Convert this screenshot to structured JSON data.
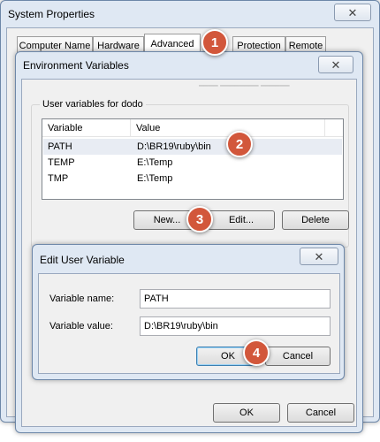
{
  "system_properties": {
    "title": "System Properties",
    "close_glyph": "✕",
    "tabs": [
      {
        "label": "Computer Name"
      },
      {
        "label": "Hardware"
      },
      {
        "label": "Advanced",
        "active": true
      },
      {
        "label": "Protection"
      },
      {
        "label": "Remote"
      }
    ]
  },
  "env_vars": {
    "title": "Environment Variables",
    "close_glyph": "✕",
    "user_group_label": "User variables for dodo",
    "columns": [
      "Variable",
      "Value"
    ],
    "rows": [
      {
        "variable": "PATH",
        "value": "D:\\BR19\\ruby\\bin",
        "selected": true
      },
      {
        "variable": "TEMP",
        "value": "E:\\Temp"
      },
      {
        "variable": "TMP",
        "value": "E:\\Temp"
      }
    ],
    "new_label": "New...",
    "edit_label": "Edit...",
    "delete_label": "Delete",
    "ok_label": "OK",
    "cancel_label": "Cancel"
  },
  "edit_dialog": {
    "title": "Edit User Variable",
    "close_glyph": "✕",
    "name_label": "Variable name:",
    "name_value": "PATH",
    "value_label": "Variable value:",
    "value_value": "D:\\BR19\\ruby\\bin",
    "ok_label": "OK",
    "cancel_label": "Cancel"
  },
  "markers": [
    "1",
    "2",
    "3",
    "4"
  ],
  "colors": {
    "marker": "#d2573b",
    "selected_row": "#e8ecf3",
    "window_frame": "#dfe8f3"
  }
}
